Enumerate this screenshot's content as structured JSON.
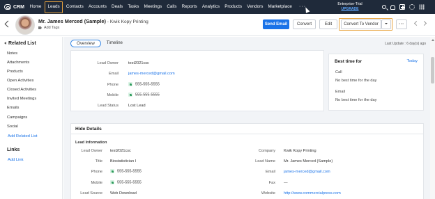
{
  "topnav": {
    "brand": "CRM",
    "items": [
      "Home",
      "Leads",
      "Contacts",
      "Accounts",
      "Deals",
      "Tasks",
      "Meetings",
      "Calls",
      "Reports",
      "Analytics",
      "Products",
      "Vendors",
      "Marketplace"
    ],
    "active_index": 1,
    "more": "···",
    "trial_label": "Enterprise-Trial",
    "upgrade_label": "UPGRADE",
    "icons": [
      "search-icon",
      "bell-icon",
      "plus-icon",
      "gear-icon",
      "apps-grid-icon"
    ],
    "colors": {
      "background": "#1f2a3a",
      "highlight": "#e8a33d",
      "upgrade": "#5fa8ff"
    }
  },
  "record": {
    "name": "Mr. James Merced (Sample)",
    "separator": " - ",
    "company": "Kwik Kopy Printing",
    "add_tags": "Add Tags",
    "buttons": {
      "send_email": "Send Email",
      "convert": "Convert",
      "edit": "Edit",
      "convert_to_vendor": "Convert To Vendor",
      "more": "···"
    },
    "primary_color": "#1a73e8"
  },
  "sidebar": {
    "related_title": "Related List",
    "related_items": [
      "Notes",
      "Attachments",
      "Products",
      "Open Activities",
      "Closed Activities",
      "Invited Meetings",
      "Emails",
      "Campaigns",
      "Social"
    ],
    "add_related": "Add Related List",
    "links_title": "Links",
    "add_link": "Add Link"
  },
  "main": {
    "tabs": [
      "Overview",
      "Timeline"
    ],
    "active_tab": 0,
    "last_update": "Last Update : 6 day(s) ago",
    "overview": [
      {
        "label": "Lead Owner",
        "value": "test2021csc"
      },
      {
        "label": "Email",
        "value": "james-merced@gmail.com",
        "link": true
      },
      {
        "label": "Phone",
        "value": "555-555-5555",
        "phone": true
      },
      {
        "label": "Mobile",
        "value": "555-555-5555",
        "phone": true
      },
      {
        "label": "Lead Status",
        "value": "Lost Lead"
      }
    ],
    "best_time": {
      "title": "Best time for",
      "today": "Today",
      "call_label": "Call",
      "call_value": "No best time for the day",
      "email_label": "Email",
      "email_value": "No best time for the day"
    },
    "hide_details": "Hide Details",
    "lead_information": "Lead Information",
    "info_left": [
      {
        "label": "Lead Owner",
        "value": "test2021csc"
      },
      {
        "label": "Title",
        "value": "Biostatistician I"
      },
      {
        "label": "Phone",
        "value": "555-555-5555",
        "phone": true
      },
      {
        "label": "Mobile",
        "value": "555-555-5555",
        "phone": true
      },
      {
        "label": "Lead Source",
        "value": "Web Download"
      }
    ],
    "info_right": [
      {
        "label": "Company",
        "value": "Kwik Kopy Printing"
      },
      {
        "label": "Lead Name",
        "value": "Mr. James Merced (Sample)"
      },
      {
        "label": "Email",
        "value": "james-merced@gmail.com",
        "link": true
      },
      {
        "label": "Fax",
        "value": "—"
      },
      {
        "label": "Website",
        "value": "http://www.commercialpress.com",
        "link": true
      }
    ]
  }
}
